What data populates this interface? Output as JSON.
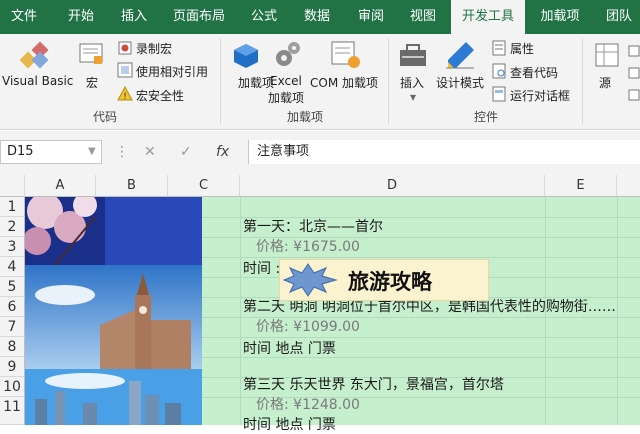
{
  "tabs": [
    "文件",
    "开始",
    "插入",
    "页面布局",
    "公式",
    "数据",
    "审阅",
    "视图",
    "开发工具",
    "加载项",
    "团队"
  ],
  "active_tab": "开发工具",
  "ribbon": {
    "code": {
      "visual_basic": "Visual Basic",
      "macros": "宏",
      "record_macro": "录制宏",
      "relative_ref": "使用相对引用",
      "macro_security": "宏安全性",
      "group_label": "代码"
    },
    "addins": {
      "addins": "加载项",
      "excel_addins_1": "Excel",
      "excel_addins_2": "加载项",
      "com_addins": "COM 加载项",
      "group_label": "加载项"
    },
    "controls": {
      "insert": "插入",
      "design_mode": "设计模式",
      "properties": "属性",
      "view_code": "查看代码",
      "run_dialog": "运行对话框",
      "group_label": "控件"
    },
    "xml": {
      "source": "源"
    }
  },
  "formula_bar": {
    "name_box": "D15",
    "cancel_symbol": "✕",
    "enter_symbol": "✓",
    "fx_symbol": "fx",
    "formula": "注意事项"
  },
  "columns": [
    "A",
    "B",
    "C",
    "D",
    "E"
  ],
  "rows": [
    "1",
    "2",
    "3",
    "4",
    "5",
    "6",
    "7",
    "8",
    "9",
    "10",
    "11"
  ],
  "cells": {
    "day1": "第一天：北京——首尔",
    "price1": "价格: ¥1675.00",
    "timeplace1": "时间 :",
    "day2": "第二天 明洞 明洞位于首尔中区，是韩国代表性的购物街……",
    "price2": "价格: ¥1099.00",
    "timeplace2": "时间 地点 门票",
    "day3": "第三天 乐天世界 东大门，景福宫，首尔塔",
    "price3": "价格: ¥1248.00",
    "timeplace3": "时间 地点 门票"
  },
  "banner": {
    "title": "旅游攻略"
  },
  "colors": {
    "accent": "#217346",
    "cell_fill": "#c6efce",
    "banner_fill": "#fbf2d0"
  }
}
